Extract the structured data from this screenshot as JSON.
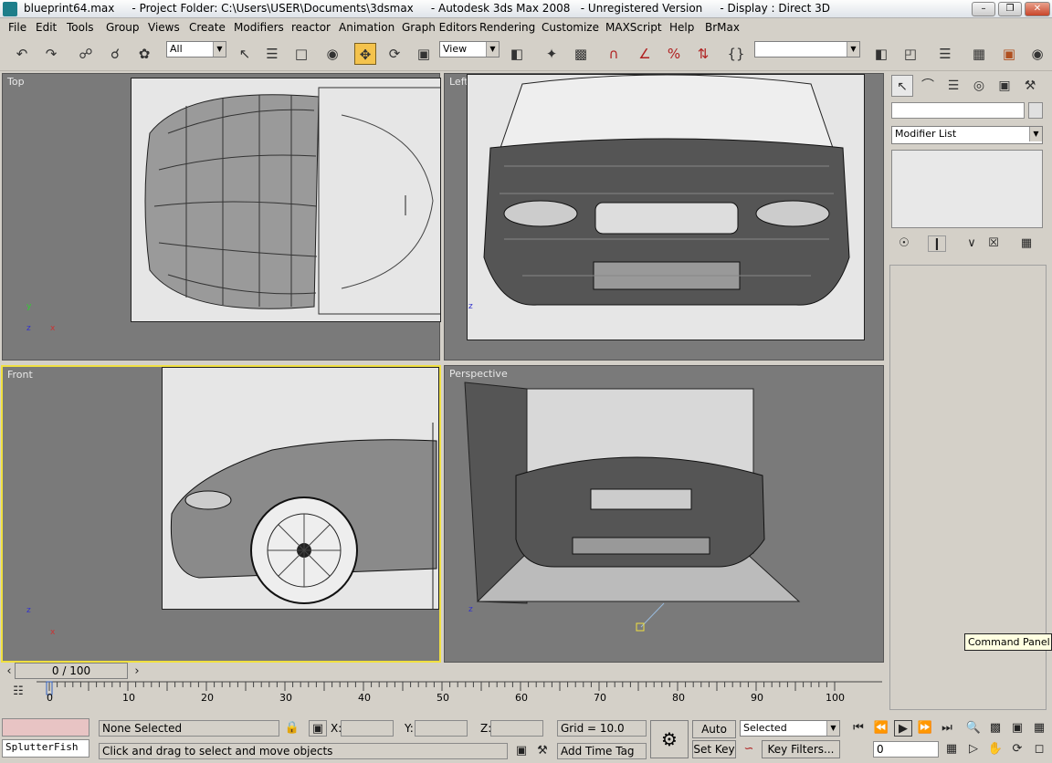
{
  "title": {
    "text": "blueprint64.max     - Project Folder: C:\\Users\\USER\\Documents\\3dsmax     - Autodesk 3ds Max 2008   - Unregistered Version     - Display : Direct 3D",
    "app_icon": "3ds"
  },
  "menu": [
    "File",
    "Edit",
    "Tools",
    "Group",
    "Views",
    "Create",
    "Modifiers",
    "reactor",
    "Animation",
    "Graph Editors",
    "Rendering",
    "Customize",
    "MAXScript",
    "Help",
    "BrMax"
  ],
  "toolbar": {
    "selection_filter": "All",
    "ref_coord": "View",
    "named_selection": ""
  },
  "viewports": {
    "top": "Top",
    "left": "Left",
    "front": "Front",
    "perspective": "Perspective"
  },
  "axes": {
    "x": "x",
    "y": "y",
    "z": "z"
  },
  "command_panel": {
    "name_field": "",
    "modifier_list": "Modifier List",
    "tooltip": "Command Panel"
  },
  "timeline": {
    "slider_label": "0 / 100",
    "ticks": [
      "0",
      "10",
      "20",
      "30",
      "40",
      "50",
      "60",
      "70",
      "80",
      "90",
      "100"
    ]
  },
  "status": {
    "script_listener": "SplutterFish",
    "selection": "None Selected",
    "prompt": "Click and drag to select and move objects",
    "x_label": "X:",
    "y_label": "Y:",
    "z_label": "Z:",
    "grid": "Grid = 10.0",
    "add_time_tag": "Add Time Tag",
    "auto_key": "Auto Key",
    "set_key": "Set Key",
    "key_mode": "Selected",
    "key_filters": "Key Filters...",
    "frame": "0"
  }
}
